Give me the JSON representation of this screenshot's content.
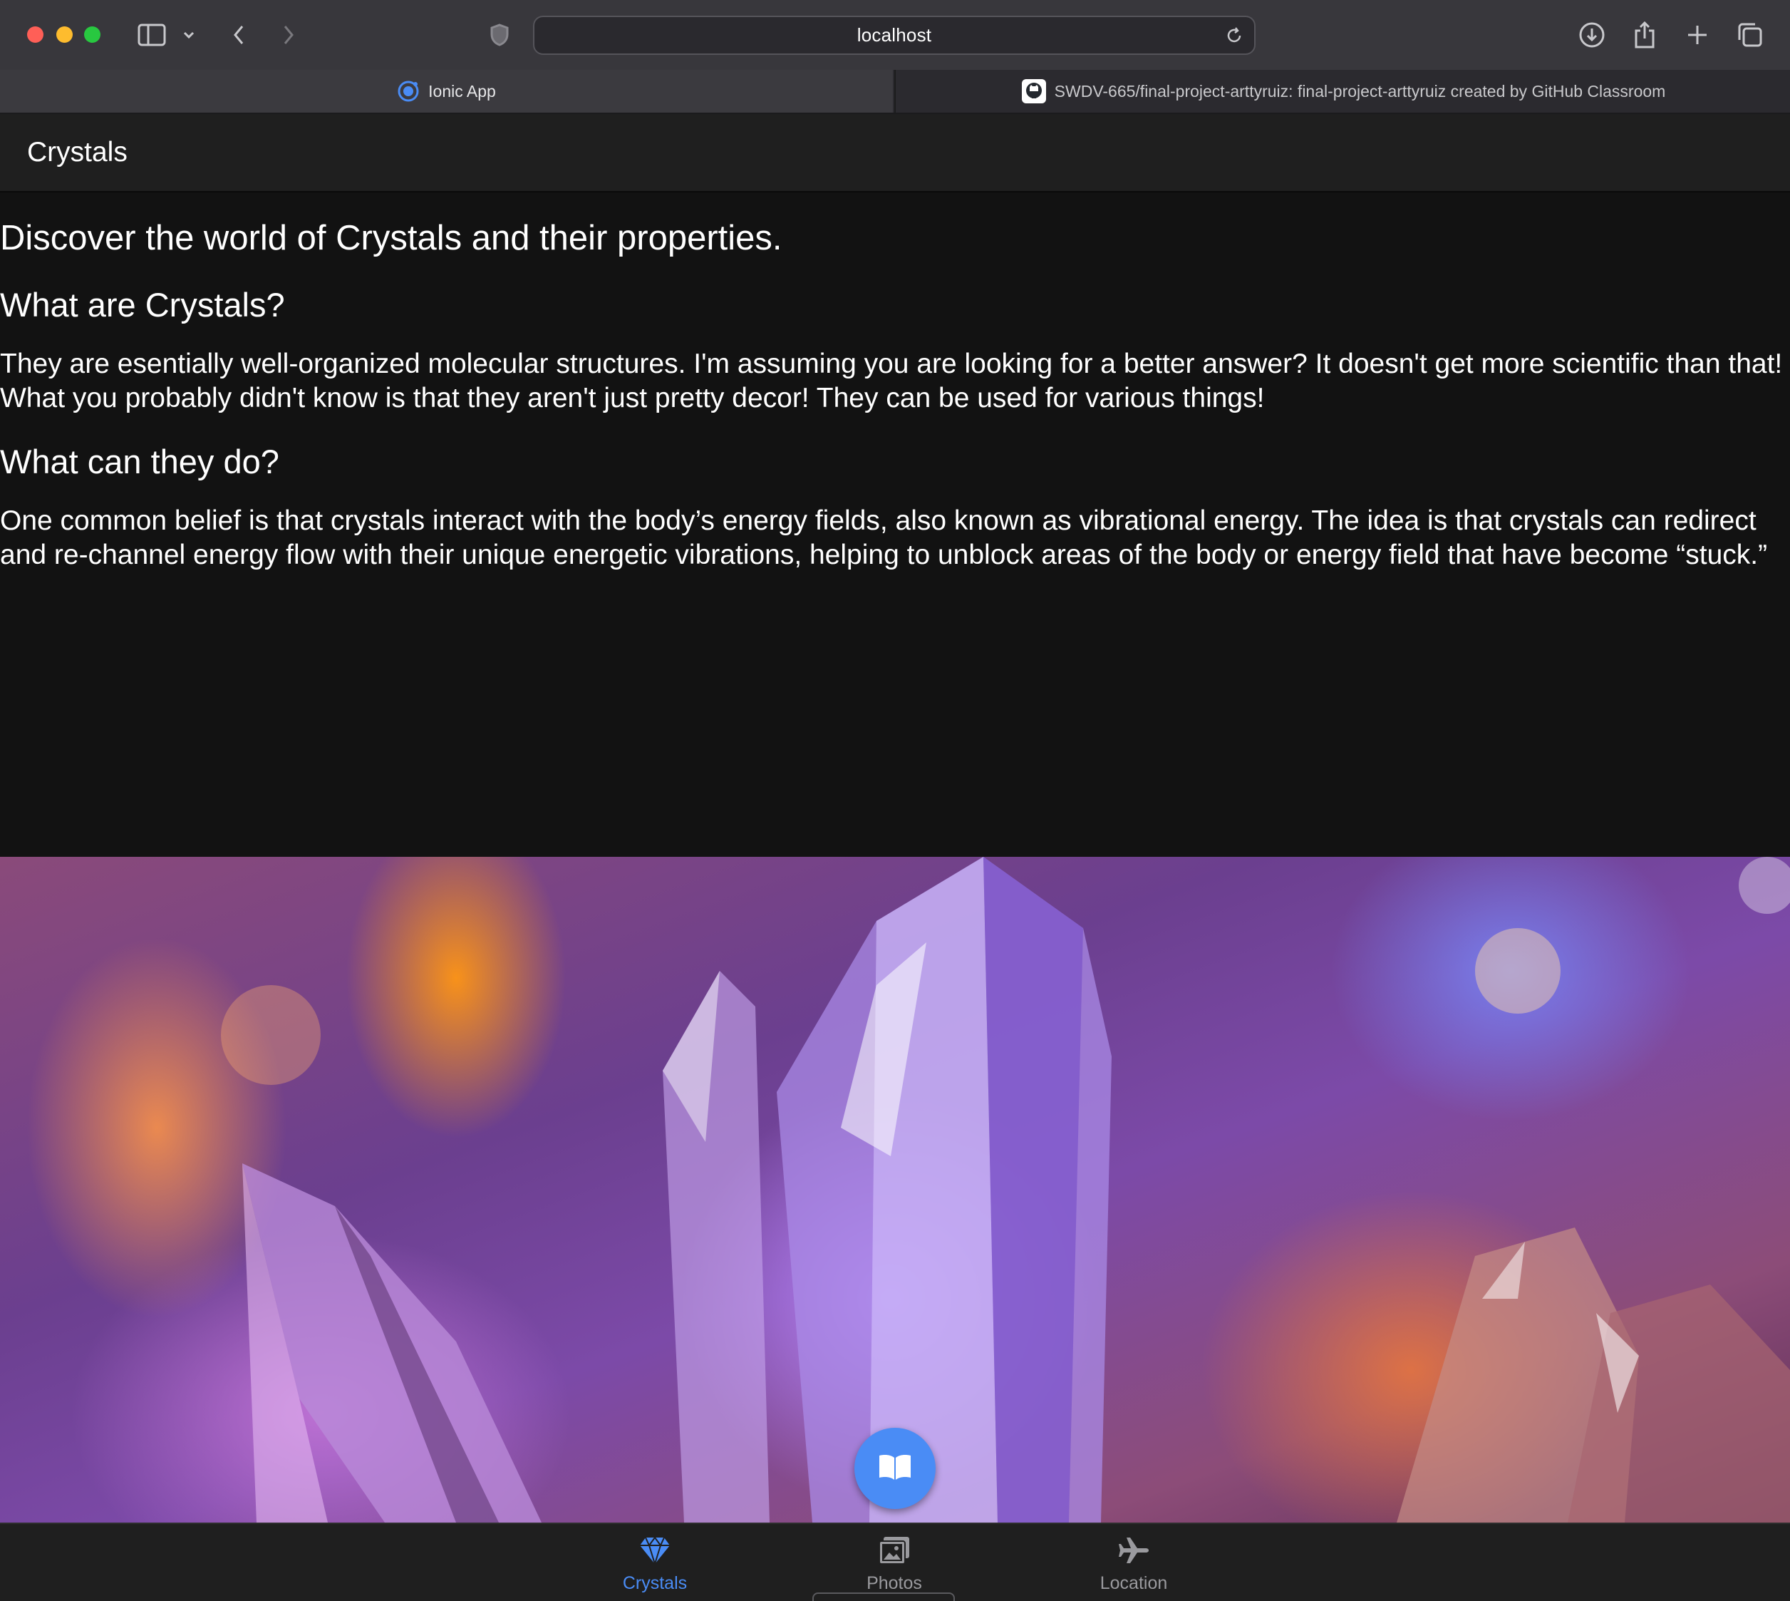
{
  "browser": {
    "url": "localhost",
    "tabs": [
      {
        "label": "Ionic App",
        "active": true,
        "icon": "ionic-logo-icon"
      },
      {
        "label": "SWDV-665/final-project-arttyruiz: final-project-arttyruiz created by GitHub Classroom",
        "active": false,
        "icon": "github-icon"
      }
    ]
  },
  "app": {
    "header_title": "Crystals",
    "content": {
      "heading": "Discover the world of Crystals and their properties.",
      "section1_title": "What are Crystals?",
      "section1_text": "They are esentially well-organized molecular structures. I'm assuming you are looking for a better answer? It doesn't get more scientific than that! What you probably didn't know is that they aren't just pretty decor! They can be used for various things!",
      "section2_title": "What can they do?",
      "section2_text": "One common belief is that crystals interact with the body’s energy fields, also known as vibrational energy. The idea is that crystals can redirect and re-channel energy flow with their unique energetic vibrations, helping to unblock areas of the body or energy field that have become “stuck.”"
    },
    "fab_icon": "book-icon",
    "tabbar": [
      {
        "label": "Crystals",
        "icon": "diamond-icon",
        "selected": true
      },
      {
        "label": "Photos",
        "icon": "images-icon",
        "selected": false
      },
      {
        "label": "Location",
        "icon": "airplane-icon",
        "selected": false
      }
    ]
  },
  "colors": {
    "accent": "#4a8cf5",
    "background": "#121212",
    "toolbar": "#1f1f1f"
  }
}
